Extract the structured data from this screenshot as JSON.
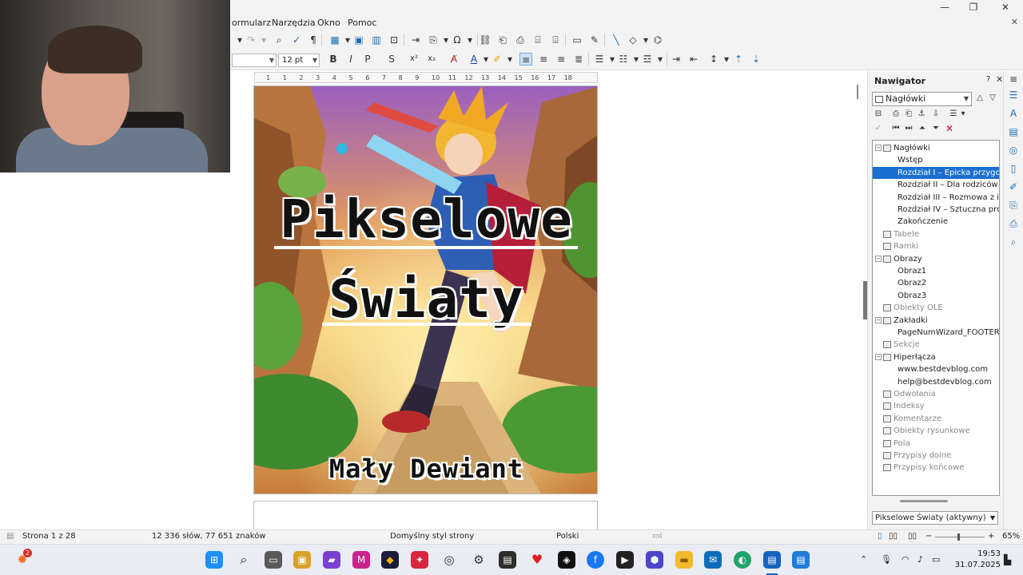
{
  "window": {
    "minimize": "—",
    "maximize": "❐",
    "close": "✕",
    "close_doc": "✕"
  },
  "menubar": {
    "items": [
      {
        "label": "ormularz",
        "underline": ""
      },
      {
        "label": "Narzędzia",
        "underline": ""
      },
      {
        "label": "Okno",
        "underline": ""
      },
      {
        "label": "Pomoc",
        "underline": ""
      }
    ]
  },
  "toolbar2": {
    "font_name": "",
    "font_size": "12 pt",
    "bold": "B",
    "italic": "I",
    "underline": "P",
    "strike": "S"
  },
  "ruler": {
    "ticks": [
      "1",
      "1",
      "2",
      "3",
      "4",
      "5",
      "6",
      "7",
      "8",
      "9",
      "10",
      "11",
      "12",
      "13",
      "14",
      "15",
      "16",
      "17",
      "18"
    ]
  },
  "document": {
    "cover": {
      "title_line1": "Pikselowe",
      "title_line2": "Światy",
      "author": "Mały Dewiant"
    }
  },
  "navigator": {
    "title": "Nawigator",
    "help": "?",
    "category_select": "Nagłówki",
    "tree": [
      {
        "label": "Nagłówki",
        "level": 0,
        "expander": "⊟",
        "icon": true,
        "dim": false,
        "selected": false
      },
      {
        "label": "Wstęp",
        "level": 1,
        "expander": "",
        "icon": false,
        "dim": false,
        "selected": false
      },
      {
        "label": "Rozdział I – Epicka przygoda",
        "level": 1,
        "expander": "",
        "icon": false,
        "dim": false,
        "selected": true
      },
      {
        "label": "Rozdział II – Dla rodziców do",
        "level": 1,
        "expander": "",
        "icon": false,
        "dim": false,
        "selected": false
      },
      {
        "label": "Rozdział III – Rozmowa z info",
        "level": 1,
        "expander": "",
        "icon": false,
        "dim": false,
        "selected": false
      },
      {
        "label": "Rozdział IV – Sztuczna prowo",
        "level": 1,
        "expander": "",
        "icon": false,
        "dim": false,
        "selected": false
      },
      {
        "label": "Zakończenie",
        "level": 1,
        "expander": "",
        "icon": false,
        "dim": false,
        "selected": false
      },
      {
        "label": "Tabele",
        "level": 0,
        "expander": "",
        "icon": true,
        "dim": true,
        "selected": false
      },
      {
        "label": "Ramki",
        "level": 0,
        "expander": "",
        "icon": true,
        "dim": true,
        "selected": false
      },
      {
        "label": "Obrazy",
        "level": 0,
        "expander": "⊟",
        "icon": true,
        "dim": false,
        "selected": false
      },
      {
        "label": "Obraz1",
        "level": 1,
        "expander": "",
        "icon": false,
        "dim": false,
        "selected": false
      },
      {
        "label": "Obraz2",
        "level": 1,
        "expander": "",
        "icon": false,
        "dim": false,
        "selected": false
      },
      {
        "label": "Obraz3",
        "level": 1,
        "expander": "",
        "icon": false,
        "dim": false,
        "selected": false
      },
      {
        "label": "Obiekty OLE",
        "level": 0,
        "expander": "",
        "icon": true,
        "dim": true,
        "selected": false
      },
      {
        "label": "Zakładki",
        "level": 0,
        "expander": "⊟",
        "icon": true,
        "dim": false,
        "selected": false
      },
      {
        "label": "PageNumWizard_FOOTER_De",
        "level": 1,
        "expander": "",
        "icon": false,
        "dim": false,
        "selected": false
      },
      {
        "label": "Sekcje",
        "level": 0,
        "expander": "",
        "icon": true,
        "dim": true,
        "selected": false
      },
      {
        "label": "Hiperłącza",
        "level": 0,
        "expander": "⊟",
        "icon": true,
        "dim": false,
        "selected": false
      },
      {
        "label": "www.bestdevblog.com",
        "level": 1,
        "expander": "",
        "icon": false,
        "dim": false,
        "selected": false
      },
      {
        "label": "help@bestdevblog.com",
        "level": 1,
        "expander": "",
        "icon": false,
        "dim": false,
        "selected": false
      },
      {
        "label": "Odwołania",
        "level": 0,
        "expander": "",
        "icon": true,
        "dim": true,
        "selected": false
      },
      {
        "label": "Indeksy",
        "level": 0,
        "expander": "",
        "icon": true,
        "dim": true,
        "selected": false
      },
      {
        "label": "Komentarze",
        "level": 0,
        "expander": "",
        "icon": true,
        "dim": true,
        "selected": false
      },
      {
        "label": "Obiekty rysunkowe",
        "level": 0,
        "expander": "",
        "icon": true,
        "dim": true,
        "selected": false
      },
      {
        "label": "Pola",
        "level": 0,
        "expander": "",
        "icon": true,
        "dim": true,
        "selected": false
      },
      {
        "label": "Przypisy dolne",
        "level": 0,
        "expander": "",
        "icon": true,
        "dim": true,
        "selected": false
      },
      {
        "label": "Przypisy końcowe",
        "level": 0,
        "expander": "",
        "icon": true,
        "dim": true,
        "selected": false
      }
    ],
    "document_select": "Pikselowe Światy (aktywny)"
  },
  "statusbar": {
    "page": "Strona 1 z 28",
    "words": "12 336 słów, 77 651 znaków",
    "page_style": "Domyślny styl strony",
    "language": "Polski",
    "zoom": "65%"
  },
  "taskbar": {
    "notification_badge": "2",
    "time": "19:53",
    "date": "31.07.2025"
  },
  "colors": {
    "selection": "#1a6fd0",
    "accent": "#1a6fb5"
  }
}
